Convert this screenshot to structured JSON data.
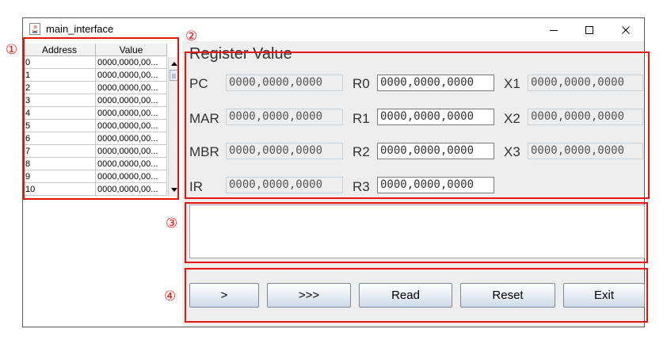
{
  "window": {
    "title": "main_interface"
  },
  "memory_table": {
    "headers": [
      "Address",
      "Value"
    ],
    "rows": [
      {
        "address": "0",
        "value": "0000,0000,00..."
      },
      {
        "address": "1",
        "value": "0000,0000,00..."
      },
      {
        "address": "2",
        "value": "0000,0000,00..."
      },
      {
        "address": "3",
        "value": "0000,0000,00..."
      },
      {
        "address": "4",
        "value": "0000,0000,00..."
      },
      {
        "address": "5",
        "value": "0000,0000,00..."
      },
      {
        "address": "6",
        "value": "0000,0000,00..."
      },
      {
        "address": "7",
        "value": "0000,0000,00..."
      },
      {
        "address": "8",
        "value": "0000,0000,00..."
      },
      {
        "address": "9",
        "value": "0000,0000,00..."
      },
      {
        "address": "10",
        "value": "0000,0000,00..."
      }
    ]
  },
  "registers": {
    "title": "Register Value",
    "PC": {
      "label": "PC",
      "value": "0000,0000,0000"
    },
    "MAR": {
      "label": "MAR",
      "value": "0000,0000,0000"
    },
    "MBR": {
      "label": "MBR",
      "value": "0000,0000,0000"
    },
    "IR": {
      "label": "IR",
      "value": "0000,0000,0000"
    },
    "R0": {
      "label": "R0",
      "value": "0000,0000,0000"
    },
    "R1": {
      "label": "R1",
      "value": "0000,0000,0000"
    },
    "R2": {
      "label": "R2",
      "value": "0000,0000,0000"
    },
    "R3": {
      "label": "R3",
      "value": "0000,0000,0000"
    },
    "X1": {
      "label": "X1",
      "value": "0000,0000,0000"
    },
    "X2": {
      "label": "X2",
      "value": "0000,0000,0000"
    },
    "X3": {
      "label": "X3",
      "value": "0000,0000,0000"
    }
  },
  "output": {
    "text": ""
  },
  "buttons": {
    "step": ">",
    "run": ">>>",
    "read": "Read",
    "reset": "Reset",
    "exit": "Exit"
  },
  "annotations": {
    "m1": "①",
    "m2": "②",
    "m3": "③",
    "m4": "④",
    "color": "#e8140c"
  },
  "icons": [
    "java-app-icon",
    "minimize-icon",
    "maximize-icon",
    "close-icon",
    "scroll-up-icon",
    "scroll-down-icon"
  ]
}
